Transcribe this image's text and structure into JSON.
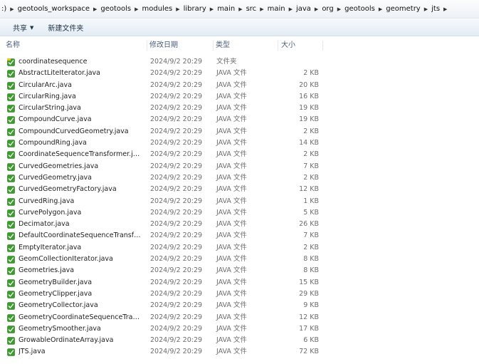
{
  "breadcrumb": {
    "prefix": ":)",
    "items": [
      "geotools_workspace",
      "geotools",
      "modules",
      "library",
      "main",
      "src",
      "main",
      "java",
      "org",
      "geotools",
      "geometry",
      "jts"
    ]
  },
  "toolbar": {
    "share_label": "共享",
    "new_folder_label": "新建文件夹"
  },
  "columns": {
    "name": "名称",
    "date": "修改日期",
    "type": "类型",
    "size": "大小"
  },
  "files": [
    {
      "name": "coordinatesequence",
      "date": "2024/9/2 20:29",
      "type": "文件夹",
      "size": ""
    },
    {
      "name": "AbstractLiteIterator.java",
      "date": "2024/9/2 20:29",
      "type": "JAVA 文件",
      "size": "2 KB"
    },
    {
      "name": "CircularArc.java",
      "date": "2024/9/2 20:29",
      "type": "JAVA 文件",
      "size": "20 KB"
    },
    {
      "name": "CircularRing.java",
      "date": "2024/9/2 20:29",
      "type": "JAVA 文件",
      "size": "16 KB"
    },
    {
      "name": "CircularString.java",
      "date": "2024/9/2 20:29",
      "type": "JAVA 文件",
      "size": "19 KB"
    },
    {
      "name": "CompoundCurve.java",
      "date": "2024/9/2 20:29",
      "type": "JAVA 文件",
      "size": "19 KB"
    },
    {
      "name": "CompoundCurvedGeometry.java",
      "date": "2024/9/2 20:29",
      "type": "JAVA 文件",
      "size": "2 KB"
    },
    {
      "name": "CompoundRing.java",
      "date": "2024/9/2 20:29",
      "type": "JAVA 文件",
      "size": "14 KB"
    },
    {
      "name": "CoordinateSequenceTransformer.java",
      "date": "2024/9/2 20:29",
      "type": "JAVA 文件",
      "size": "2 KB"
    },
    {
      "name": "CurvedGeometries.java",
      "date": "2024/9/2 20:29",
      "type": "JAVA 文件",
      "size": "7 KB"
    },
    {
      "name": "CurvedGeometry.java",
      "date": "2024/9/2 20:29",
      "type": "JAVA 文件",
      "size": "2 KB"
    },
    {
      "name": "CurvedGeometryFactory.java",
      "date": "2024/9/2 20:29",
      "type": "JAVA 文件",
      "size": "12 KB"
    },
    {
      "name": "CurvedRing.java",
      "date": "2024/9/2 20:29",
      "type": "JAVA 文件",
      "size": "1 KB"
    },
    {
      "name": "CurvePolygon.java",
      "date": "2024/9/2 20:29",
      "type": "JAVA 文件",
      "size": "5 KB"
    },
    {
      "name": "Decimator.java",
      "date": "2024/9/2 20:29",
      "type": "JAVA 文件",
      "size": "26 KB"
    },
    {
      "name": "DefaultCoordinateSequenceTransfor...",
      "date": "2024/9/2 20:29",
      "type": "JAVA 文件",
      "size": "7 KB"
    },
    {
      "name": "EmptyIterator.java",
      "date": "2024/9/2 20:29",
      "type": "JAVA 文件",
      "size": "2 KB"
    },
    {
      "name": "GeomCollectionIterator.java",
      "date": "2024/9/2 20:29",
      "type": "JAVA 文件",
      "size": "8 KB"
    },
    {
      "name": "Geometries.java",
      "date": "2024/9/2 20:29",
      "type": "JAVA 文件",
      "size": "8 KB"
    },
    {
      "name": "GeometryBuilder.java",
      "date": "2024/9/2 20:29",
      "type": "JAVA 文件",
      "size": "15 KB"
    },
    {
      "name": "GeometryClipper.java",
      "date": "2024/9/2 20:29",
      "type": "JAVA 文件",
      "size": "29 KB"
    },
    {
      "name": "GeometryCollector.java",
      "date": "2024/9/2 20:29",
      "type": "JAVA 文件",
      "size": "9 KB"
    },
    {
      "name": "GeometryCoordinateSequenceTransf...",
      "date": "2024/9/2 20:29",
      "type": "JAVA 文件",
      "size": "12 KB"
    },
    {
      "name": "GeometrySmoother.java",
      "date": "2024/9/2 20:29",
      "type": "JAVA 文件",
      "size": "17 KB"
    },
    {
      "name": "GrowableOrdinateArray.java",
      "date": "2024/9/2 20:29",
      "type": "JAVA 文件",
      "size": "6 KB"
    },
    {
      "name": "JTS.java",
      "date": "2024/9/2 20:29",
      "type": "JAVA 文件",
      "size": "72 KB"
    }
  ],
  "colors": {
    "icon_green": "#3d9a2f",
    "icon_yellow": "#e8c52a",
    "header_text": "#4c607a"
  },
  "icons": {
    "breadcrumb_separator": "chevron-right-icon",
    "dropdown": "caret-down-icon",
    "file": "java-file-icon",
    "folder": "java-folder-icon"
  }
}
